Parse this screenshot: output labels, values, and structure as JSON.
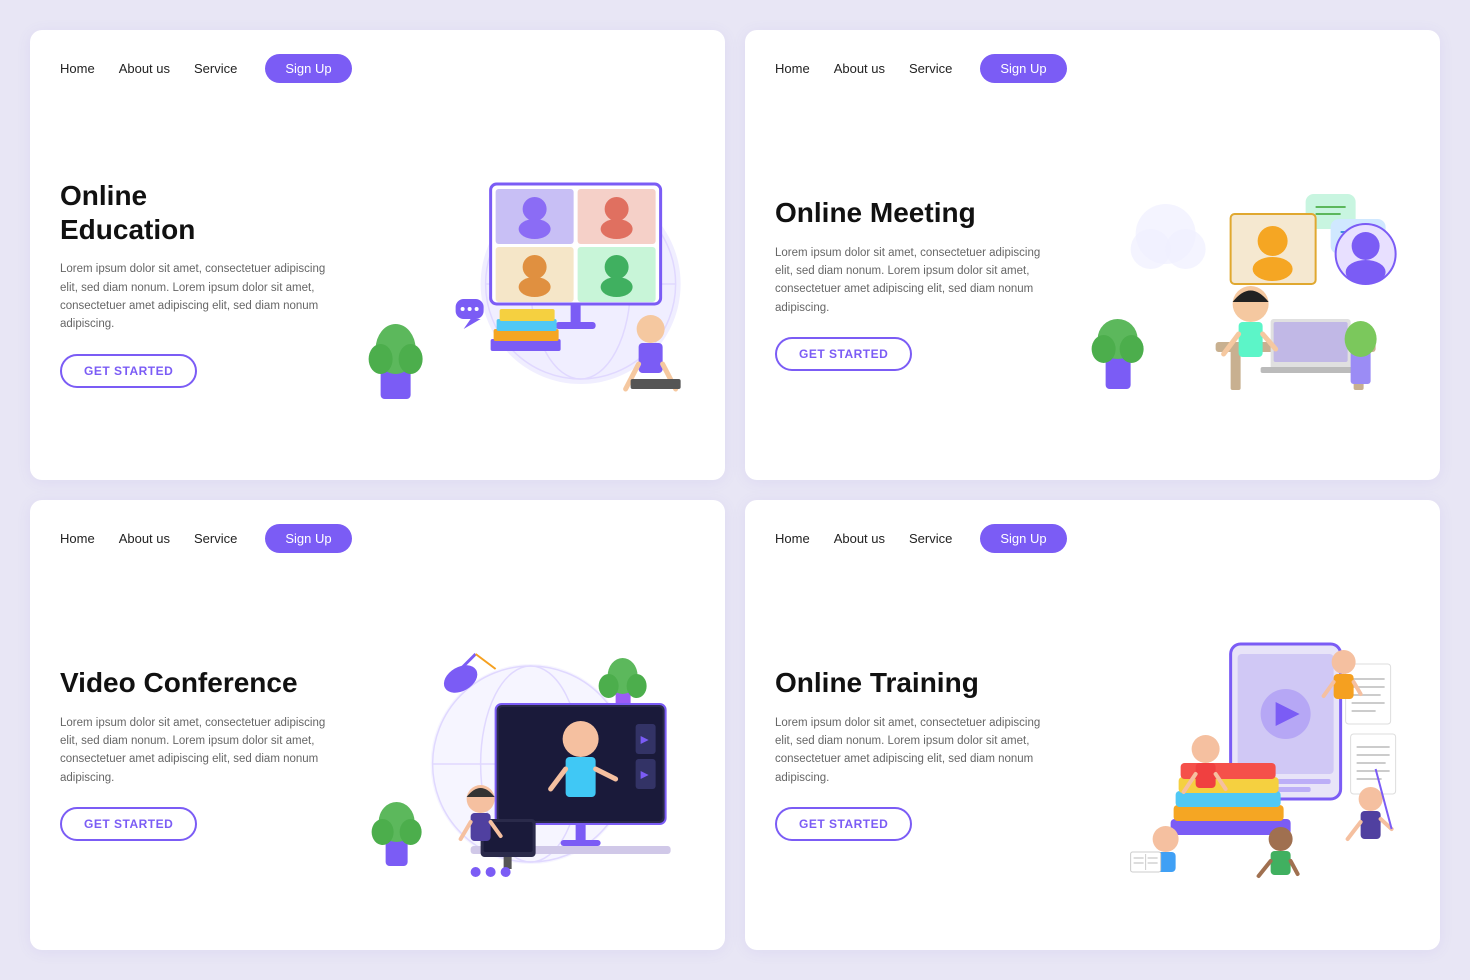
{
  "cards": [
    {
      "id": "online-education",
      "nav": {
        "home": "Home",
        "about": "About us",
        "service": "Service",
        "signup": "Sign Up"
      },
      "title": "Online\nEducation",
      "description": "Lorem ipsum dolor sit amet, consectetuer adipiscing elit, sed diam nonum. Lorem ipsum dolor sit amet, consectetuer amet adipiscing elit, sed diam nonum adipiscing.",
      "cta": "GET STARTED",
      "illustration": "education"
    },
    {
      "id": "online-meeting",
      "nav": {
        "home": "Home",
        "about": "About us",
        "service": "Service",
        "signup": "Sign Up"
      },
      "title": "Online Meeting",
      "description": "Lorem ipsum dolor sit amet, consectetuer adipiscing elit, sed diam nonum. Lorem ipsum dolor sit amet, consectetuer amet adipiscing elit, sed diam nonum adipiscing.",
      "cta": "GET STARTED",
      "illustration": "meeting"
    },
    {
      "id": "video-conference",
      "nav": {
        "home": "Home",
        "about": "About us",
        "service": "Service",
        "signup": "Sign Up"
      },
      "title": "Video Conference",
      "description": "Lorem ipsum dolor sit amet, consectetuer adipiscing elit, sed diam nonum. Lorem ipsum dolor sit amet, consectetuer amet adipiscing elit, sed diam nonum adipiscing.",
      "cta": "GET STARTED",
      "illustration": "conference"
    },
    {
      "id": "online-training",
      "nav": {
        "home": "Home",
        "about": "About us",
        "service": "Service",
        "signup": "Sign Up"
      },
      "title": "Online Training",
      "description": "Lorem ipsum dolor sit amet, consectetuer adipiscing elit, sed diam nonum. Lorem ipsum dolor sit amet, consectetuer amet adipiscing elit, sed diam nonum adipiscing.",
      "cta": "GET STARTED",
      "illustration": "training"
    }
  ],
  "colors": {
    "primary": "#7b5cf5",
    "background": "#e8e6f5",
    "text_dark": "#111111",
    "text_light": "#666666"
  }
}
